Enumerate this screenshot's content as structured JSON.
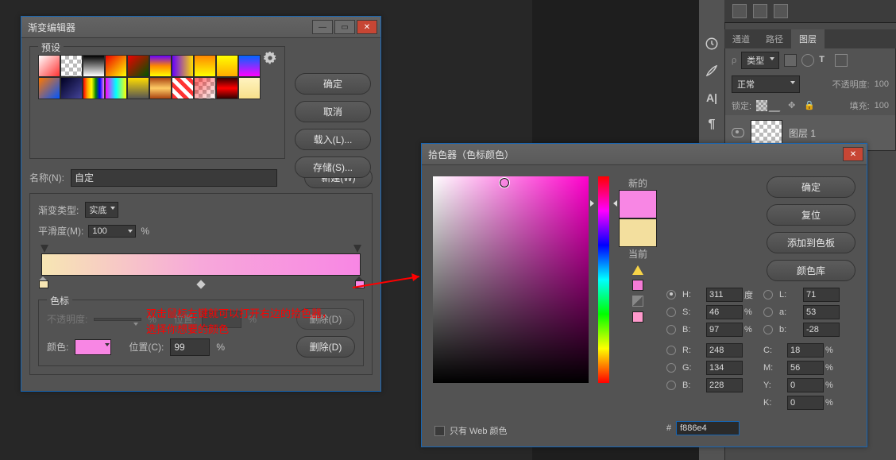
{
  "gradient_editor": {
    "title": "渐变编辑器",
    "presets_legend": "预设",
    "buttons": {
      "ok": "确定",
      "cancel": "取消",
      "load": "载入(L)...",
      "save": "存储(S)...",
      "new": "新建(W)"
    },
    "name_label": "名称(N):",
    "name_value": "自定",
    "type_label": "渐变类型:",
    "type_value": "实底",
    "smooth_label": "平滑度(M):",
    "smooth_value": "100",
    "smooth_unit": "%",
    "stops_legend": "色标",
    "opacity_label": "不透明度:",
    "pos_label": "位置:",
    "pos_unit": "%",
    "delete_btn": "删除(D)",
    "color_label": "颜色:",
    "pos2_label": "位置(C):",
    "pos2_value": "99",
    "pos2_unit": "%",
    "delete2_btn": "删除(D)"
  },
  "annotation": {
    "line1": "双击鼠标左键就可以打开右边的拾色器，",
    "line2": "选择你想要的颜色"
  },
  "color_picker": {
    "title": "拾色器（色标颜色）",
    "new_label": "新的",
    "current_label": "当前",
    "buttons": {
      "ok": "确定",
      "reset": "复位",
      "add": "添加到色板",
      "lib": "颜色库"
    },
    "H_label": "H:",
    "H_val": "311",
    "deg": "度",
    "S_label": "S:",
    "S_val": "46",
    "pct": "%",
    "B_label": "B:",
    "B_val": "97",
    "L_label": "L:",
    "L_val": "71",
    "a_label": "a:",
    "a_val": "53",
    "b2_label": "b:",
    "b2_val": "-28",
    "R_label": "R:",
    "R_val": "248",
    "G_label": "G:",
    "G_val": "134",
    "Bc_label": "B:",
    "Bc_val": "228",
    "C_label": "C:",
    "C_val": "18",
    "M_label": "M:",
    "M_val": "56",
    "Y_label": "Y:",
    "Y_val": "0",
    "K_label": "K:",
    "K_val": "0",
    "hex_label": "#",
    "hex_val": "f886e4",
    "webonly": "只有 Web 颜色",
    "new_color": "#f886e4",
    "current_color": "#f3df9e"
  },
  "right_panel": {
    "tabs": {
      "channels": "通道",
      "paths": "路径",
      "layers": "图层"
    },
    "kind": "类型",
    "blend": "正常",
    "opacity_label": "不透明度:",
    "opacity_val": "100",
    "lock_label": "锁定:",
    "fill_label": "填充:",
    "fill_val": "100",
    "layer_name": "图层 1"
  }
}
